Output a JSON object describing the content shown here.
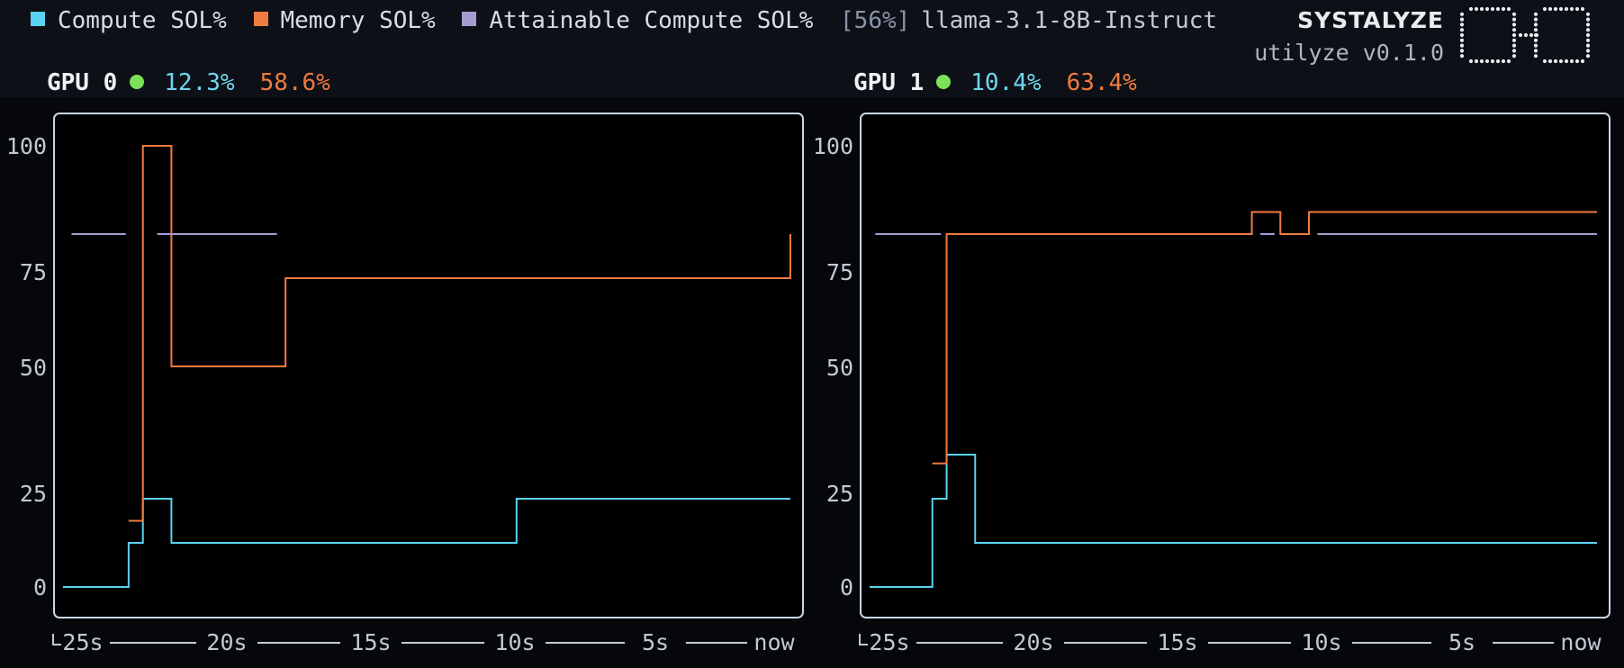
{
  "legend": [
    {
      "label": "Compute SOL%",
      "color": "#5ad3f0"
    },
    {
      "label": "Memory SOL%",
      "color": "#f07b3f"
    },
    {
      "label": "Attainable Compute SOL%",
      "color": "#a59bd0"
    }
  ],
  "attainable_badge": "[56%]",
  "model_name": "llama-3.1-8B-Instruct",
  "brand": {
    "name": "SYSTALYZE",
    "version": "utilyze v0.1.0"
  },
  "gpus": [
    {
      "label": "GPU 0",
      "status_color": "#7be35a",
      "compute_pct": "12.3%",
      "memory_pct": "58.6%",
      "chart_data": {
        "type": "line",
        "title": "",
        "xlabel": "",
        "ylabel": "",
        "xlim": [
          -25.5,
          0
        ],
        "ylim": [
          0,
          100
        ],
        "y_ticks": [
          "100",
          "75",
          "50",
          "25",
          "0"
        ],
        "x_ticks": [
          "25s",
          "20s",
          "15s",
          "10s",
          "5s",
          "now"
        ],
        "series": [
          {
            "name": "Compute SOL%",
            "color": "#5ad3f0",
            "x": [
              -25.5,
              -23.2,
              -22.7,
              -21.7,
              -9.6,
              0
            ],
            "y": [
              0,
              10,
              20,
              10,
              20,
              20
            ]
          },
          {
            "name": "Memory SOL%",
            "color": "#f07b3f",
            "x": [
              -23.2,
              -22.7,
              -21.7,
              -17.7,
              0
            ],
            "y": [
              15,
              100,
              50,
              70,
              80
            ]
          },
          {
            "name": "Attainable Compute SOL%",
            "color": "#a59bd0",
            "x": [
              -25.2,
              -23.2,
              -22.2,
              -18.0
            ],
            "y": [
              80,
              80,
              80,
              80
            ],
            "segments": [
              [
                -25.2,
                -23.3
              ],
              [
                -22.2,
                -18.0
              ]
            ]
          }
        ]
      }
    },
    {
      "label": "GPU 1",
      "status_color": "#7be35a",
      "compute_pct": "10.4%",
      "memory_pct": "63.4%",
      "chart_data": {
        "type": "line",
        "title": "",
        "xlabel": "",
        "ylabel": "",
        "xlim": [
          -25.5,
          0
        ],
        "ylim": [
          0,
          100
        ],
        "y_ticks": [
          "100",
          "75",
          "50",
          "25",
          "0"
        ],
        "x_ticks": [
          "25s",
          "20s",
          "15s",
          "10s",
          "5s",
          "now"
        ],
        "series": [
          {
            "name": "Compute SOL%",
            "color": "#5ad3f0",
            "x": [
              -25.5,
              -23.3,
              -22.8,
              -21.8,
              0
            ],
            "y": [
              0,
              20,
              30,
              10,
              10
            ]
          },
          {
            "name": "Memory SOL%",
            "color": "#f07b3f",
            "x": [
              -23.3,
              -22.8,
              -12.1,
              -11.1,
              -10.1,
              0
            ],
            "y": [
              28,
              80,
              85,
              80,
              85,
              85
            ]
          },
          {
            "name": "Attainable Compute SOL%",
            "color": "#a59bd0",
            "x": [
              -25.3,
              -23.0,
              -11.8,
              -11.3,
              -9.8,
              0
            ],
            "y": [
              80,
              80,
              80,
              80,
              80,
              80
            ],
            "segments": [
              [
                -25.3,
                -23.0
              ],
              [
                -11.8,
                -11.3
              ],
              [
                -9.8,
                0
              ]
            ]
          }
        ]
      }
    }
  ]
}
